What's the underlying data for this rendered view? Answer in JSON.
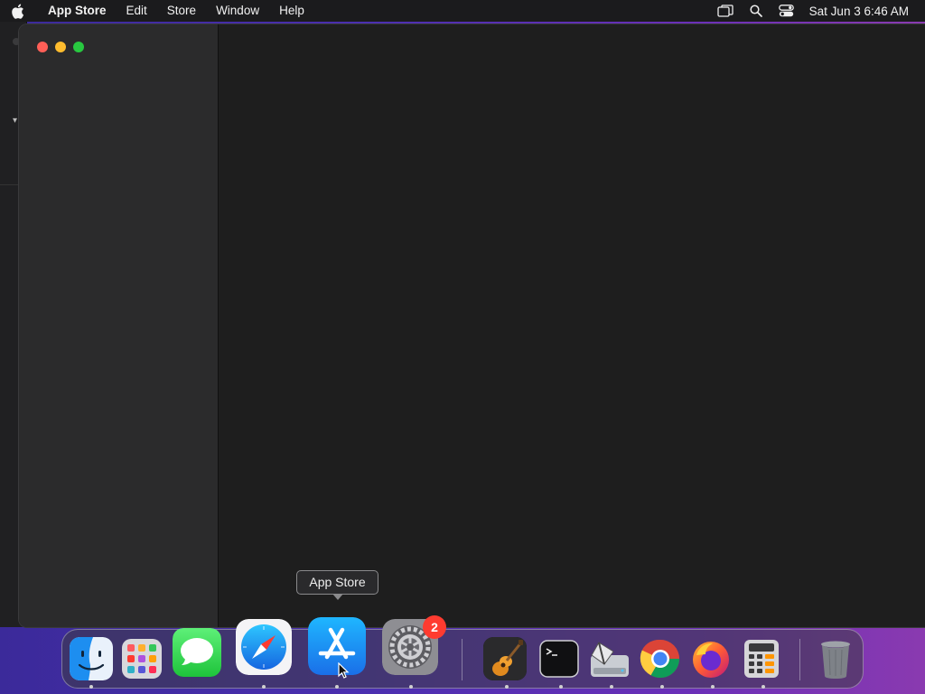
{
  "menubar": {
    "app_name": "App Store",
    "menus": [
      "Edit",
      "Store",
      "Window",
      "Help"
    ],
    "clock": "Sat Jun 3  6:46 AM",
    "status_icons": [
      "screen-mirroring-icon",
      "search-icon",
      "control-center-icon"
    ]
  },
  "tooltip": {
    "text": "App Store"
  },
  "dock": {
    "apps": [
      {
        "name": "Finder",
        "icon": "finder-icon",
        "running": true
      },
      {
        "name": "Launchpad",
        "icon": "launchpad-icon",
        "running": false
      },
      {
        "name": "Messages",
        "icon": "messages-icon",
        "running": false
      },
      {
        "name": "Safari",
        "icon": "safari-icon",
        "running": true
      },
      {
        "name": "App Store",
        "icon": "app-store-icon",
        "running": true
      },
      {
        "name": "System Settings",
        "icon": "system-settings-icon",
        "running": true,
        "badge": "2"
      },
      {
        "name": "GarageBand",
        "icon": "garageband-icon",
        "running": true
      },
      {
        "name": "Terminal",
        "icon": "terminal-icon",
        "running": true
      },
      {
        "name": "Disk Utility",
        "icon": "disk-utility-icon",
        "running": true
      },
      {
        "name": "Chrome",
        "icon": "chrome-icon",
        "running": true
      },
      {
        "name": "Firefox",
        "icon": "firefox-icon",
        "running": true
      },
      {
        "name": "Calculator",
        "icon": "calculator-icon",
        "running": true
      },
      {
        "name": "Trash",
        "icon": "trash-icon",
        "running": false
      }
    ]
  },
  "colors": {
    "close": "#ff5f57",
    "minimize": "#febc2e",
    "maximize": "#28c840",
    "badge": "#ff3b30"
  }
}
